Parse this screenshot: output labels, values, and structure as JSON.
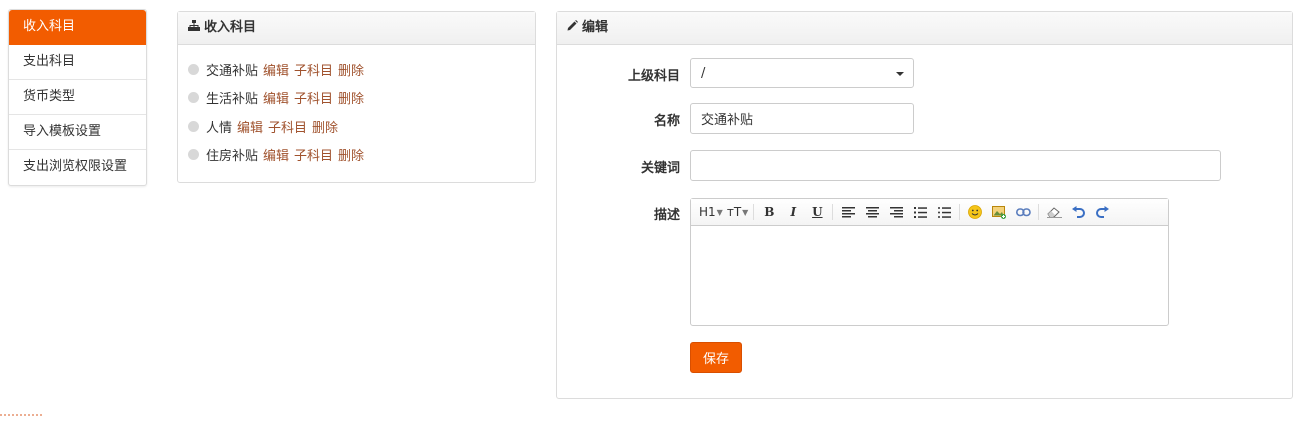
{
  "nav": {
    "items": [
      {
        "label": "收入科目",
        "active": true
      },
      {
        "label": "支出科目",
        "active": false
      },
      {
        "label": "货币类型",
        "active": false
      },
      {
        "label": "导入模板设置",
        "active": false
      },
      {
        "label": "支出浏览权限设置",
        "active": false
      }
    ]
  },
  "tree": {
    "title": "收入科目",
    "icon": "sitemap-icon",
    "items": [
      {
        "name": "交通补贴",
        "edit": "编辑",
        "child": "子科目",
        "delete": "删除"
      },
      {
        "name": "生活补贴",
        "edit": "编辑",
        "child": "子科目",
        "delete": "删除"
      },
      {
        "name": "人情",
        "edit": "编辑",
        "child": "子科目",
        "delete": "删除"
      },
      {
        "name": "住房补贴",
        "edit": "编辑",
        "child": "子科目",
        "delete": "删除"
      }
    ]
  },
  "edit": {
    "title": "编辑",
    "icon": "pencil-icon",
    "parent_label": "上级科目",
    "parent_value": "/",
    "name_label": "名称",
    "name_value": "交通补贴",
    "keyword_label": "关键词",
    "keyword_value": "",
    "desc_label": "描述",
    "toolbar": {
      "heading": "H1",
      "fontsize": "тT",
      "bold": "B",
      "italic": "I",
      "underline": "U"
    },
    "save_label": "保存"
  },
  "colors": {
    "accent": "#f25c00",
    "link": "#a0522d"
  }
}
